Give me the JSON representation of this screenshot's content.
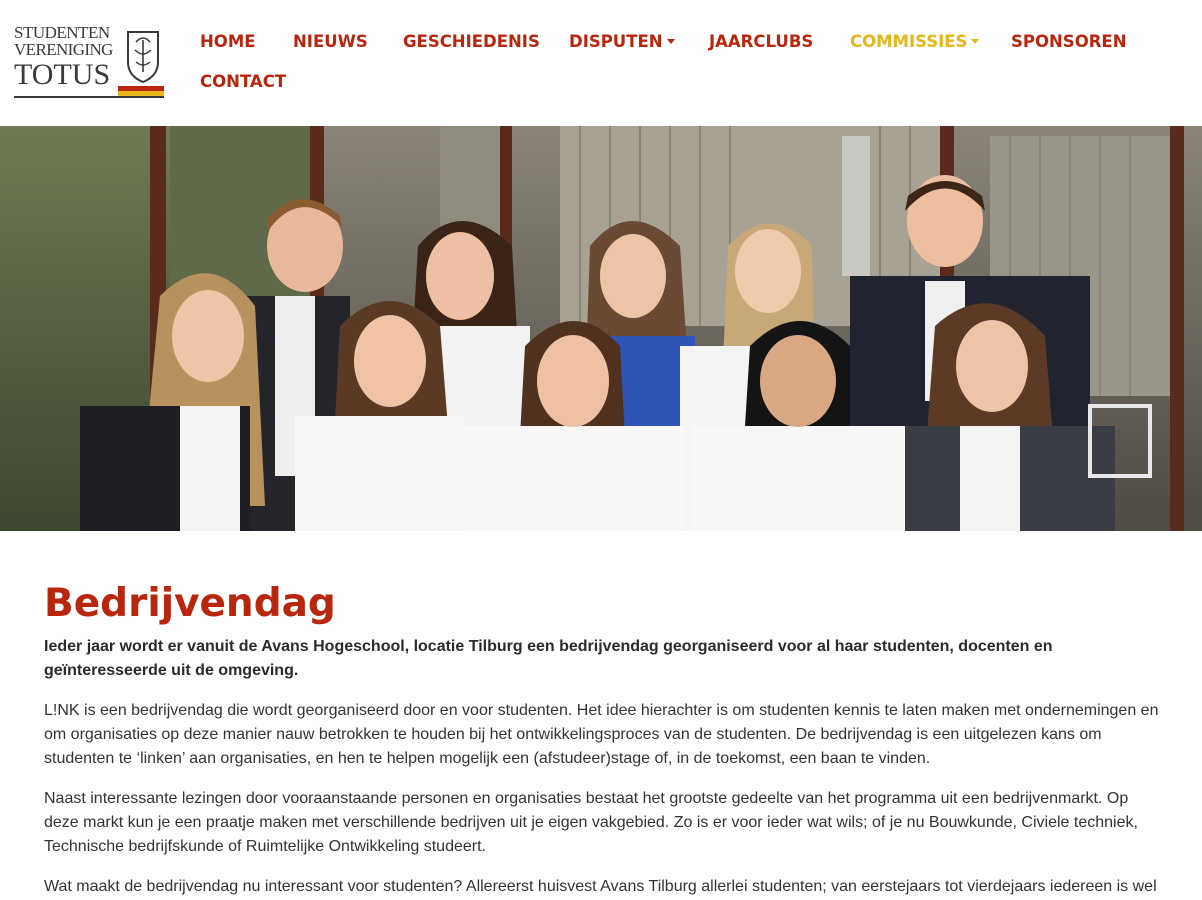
{
  "logo": {
    "line1": "STUDENTEN",
    "line2": "VERENIGING",
    "line3": "TOTUS",
    "colors": {
      "red": "#b8260e",
      "yellow": "#e6b61a",
      "ink": "#3a3a3a"
    }
  },
  "nav": {
    "home": "HOME",
    "nieuws": "NIEUWS",
    "geschiedenis": "GESCHIEDENIS",
    "disputen": "DISPUTEN",
    "jaarclubs": "JAARCLUBS",
    "commissies": "COMMISSIES",
    "sponsoren": "SPONSOREN",
    "contact": "CONTACT",
    "active": "COMMISSIES",
    "colors": {
      "default": "#b8260e",
      "active": "#e6b61a"
    }
  },
  "hero": {
    "icon": "group-photo"
  },
  "main": {
    "title": "Bedrijvendag",
    "intro": "Ieder jaar wordt er vanuit de Avans Hogeschool, locatie Tilburg een bedrijvendag georganiseerd voor al haar studenten, docenten en geïnteresseerde uit de omgeving.",
    "p1": "L!NK is een bedrijvendag die wordt georganiseerd door en voor studenten. Het idee hierachter is om studenten kennis te laten maken met ondernemingen en om organisaties op deze manier nauw betrokken te houden bij het ontwikkelingsproces van de studenten. De bedrijvendag is een uitgelezen kans om studenten te ‘linken’ aan organisaties, en hen te helpen mogelijk een (afstudeer)stage of, in de toekomst, een baan te vinden.",
    "p2": "Naast interessante lezingen door vooraanstaande personen en organisaties bestaat het grootste gedeelte van het programma uit een bedrijvenmarkt. Op deze markt kun je een praatje maken met verschillende bedrijven uit je eigen vakgebied. Zo is er voor ieder wat wils; of je nu Bouwkunde, Civiele techniek, Technische bedrijfskunde of Ruimtelijke Ontwikkeling studeert.",
    "p3": "Wat maakt de bedrijvendag nu interessant voor studenten? Allereerst huisvest Avans Tilburg allerlei studenten; van eerstejaars tot vierdejaars iedereen is wel"
  }
}
